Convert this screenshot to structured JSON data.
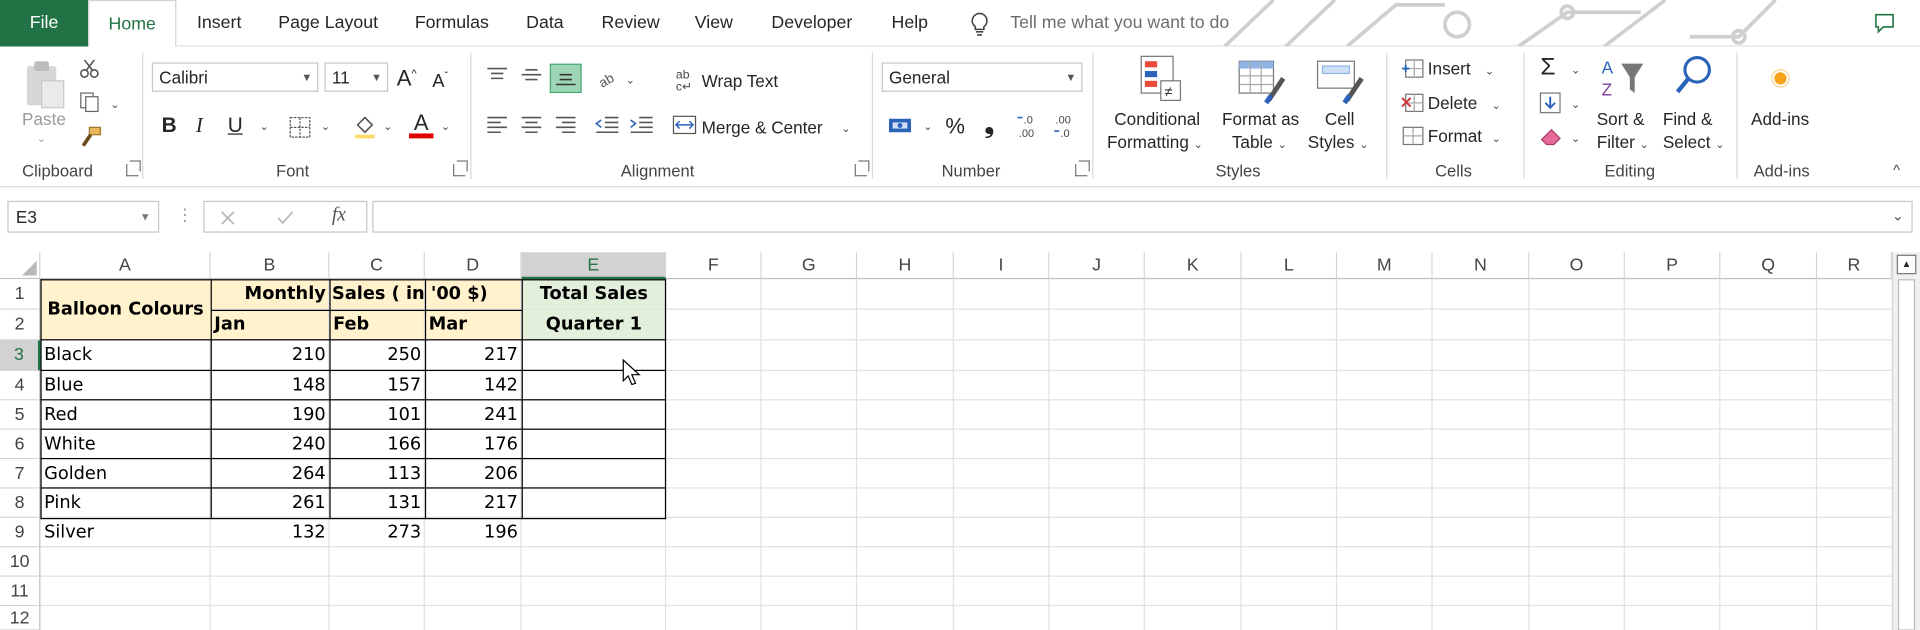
{
  "tabs": [
    "File",
    "Home",
    "Insert",
    "Page Layout",
    "Formulas",
    "Data",
    "Review",
    "View",
    "Developer",
    "Help"
  ],
  "tell_me": "Tell me what you want to do",
  "ribbon": {
    "clipboard": {
      "paste": "Paste",
      "label": "Clipboard"
    },
    "font": {
      "name": "Calibri",
      "size": "11",
      "bold": "B",
      "italic": "I",
      "underline": "U",
      "label": "Font"
    },
    "alignment": {
      "wrap_text": "Wrap Text",
      "merge_center": "Merge & Center",
      "label": "Alignment"
    },
    "number": {
      "format": "General",
      "percent": "%",
      "comma": "❟",
      "label": "Number"
    },
    "styles": {
      "conditional_1": "Conditional",
      "conditional_2": "Formatting",
      "format_table_1": "Format as",
      "format_table_2": "Table",
      "cell_styles_1": "Cell",
      "cell_styles_2": "Styles",
      "label": "Styles"
    },
    "cells": {
      "insert": "Insert",
      "delete": "Delete",
      "format": "Format",
      "label": "Cells"
    },
    "editing": {
      "sort_1": "Sort &",
      "sort_2": "Filter",
      "find_1": "Find &",
      "find_2": "Select",
      "label": "Editing"
    },
    "addins": {
      "button": "Add-ins",
      "label": "Add-ins"
    }
  },
  "formula_bar": {
    "name_box": "E3",
    "fx": "fx",
    "formula": ""
  },
  "sheet": {
    "columns": [
      "A",
      "B",
      "C",
      "D",
      "E",
      "F",
      "G",
      "H",
      "I",
      "J",
      "K",
      "L",
      "M",
      "N",
      "O",
      "P",
      "Q",
      "R"
    ],
    "selected_column": "E",
    "rows": [
      "1",
      "2",
      "3",
      "4",
      "5",
      "6",
      "7",
      "8",
      "9",
      "10",
      "11",
      "12"
    ],
    "selected_row": "3",
    "header": {
      "balloon_colours": "Balloon Colours",
      "monthly_sales": "Monthly Sales ( in '00 $)",
      "jan": "Jan",
      "feb": "Feb",
      "mar": "Mar",
      "total_1": "Total Sales",
      "total_2": "Quarter 1"
    },
    "data": [
      {
        "colour": "Black",
        "jan": "210",
        "feb": "250",
        "mar": "217"
      },
      {
        "colour": "Blue",
        "jan": "148",
        "feb": "157",
        "mar": "142"
      },
      {
        "colour": "Red",
        "jan": "190",
        "feb": "101",
        "mar": "241"
      },
      {
        "colour": "White",
        "jan": "240",
        "feb": "166",
        "mar": "176"
      },
      {
        "colour": "Golden",
        "jan": "264",
        "feb": "113",
        "mar": "206"
      },
      {
        "colour": "Pink",
        "jan": "261",
        "feb": "131",
        "mar": "217"
      },
      {
        "colour": "Silver",
        "jan": "132",
        "feb": "273",
        "mar": "196"
      }
    ],
    "colors": {
      "header_fill": "#FFF2CC",
      "total_fill": "#E2EFDA",
      "accent": "#217346"
    }
  }
}
